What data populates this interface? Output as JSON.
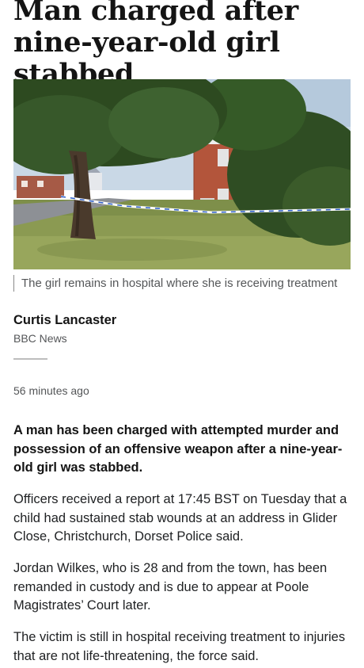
{
  "article": {
    "headline": "Man charged after nine-year-old girl stabbed",
    "image": {
      "caption": "The girl remains in hospital where she is receiving treatment"
    },
    "byline": {
      "author": "Curtis Lancaster",
      "outlet": "BBC News"
    },
    "timestamp": "56 minutes ago",
    "lede": "A man has been charged with attempted murder and possession of an offensive weapon after a nine-year-old girl was stabbed.",
    "paragraphs": [
      "Officers received a report at 17:45 BST on Tuesday that a child had sustained stab wounds at an address in Glider Close, Christchurch, Dorset Police said.",
      "Jordan Wilkes, who is 28 and from the town, has been remanded in custody and is due to appear at Poole Magistrates’ Court later.",
      "The victim is still in hospital receiving treatment to injuries that are not life-threatening, the force said."
    ]
  }
}
